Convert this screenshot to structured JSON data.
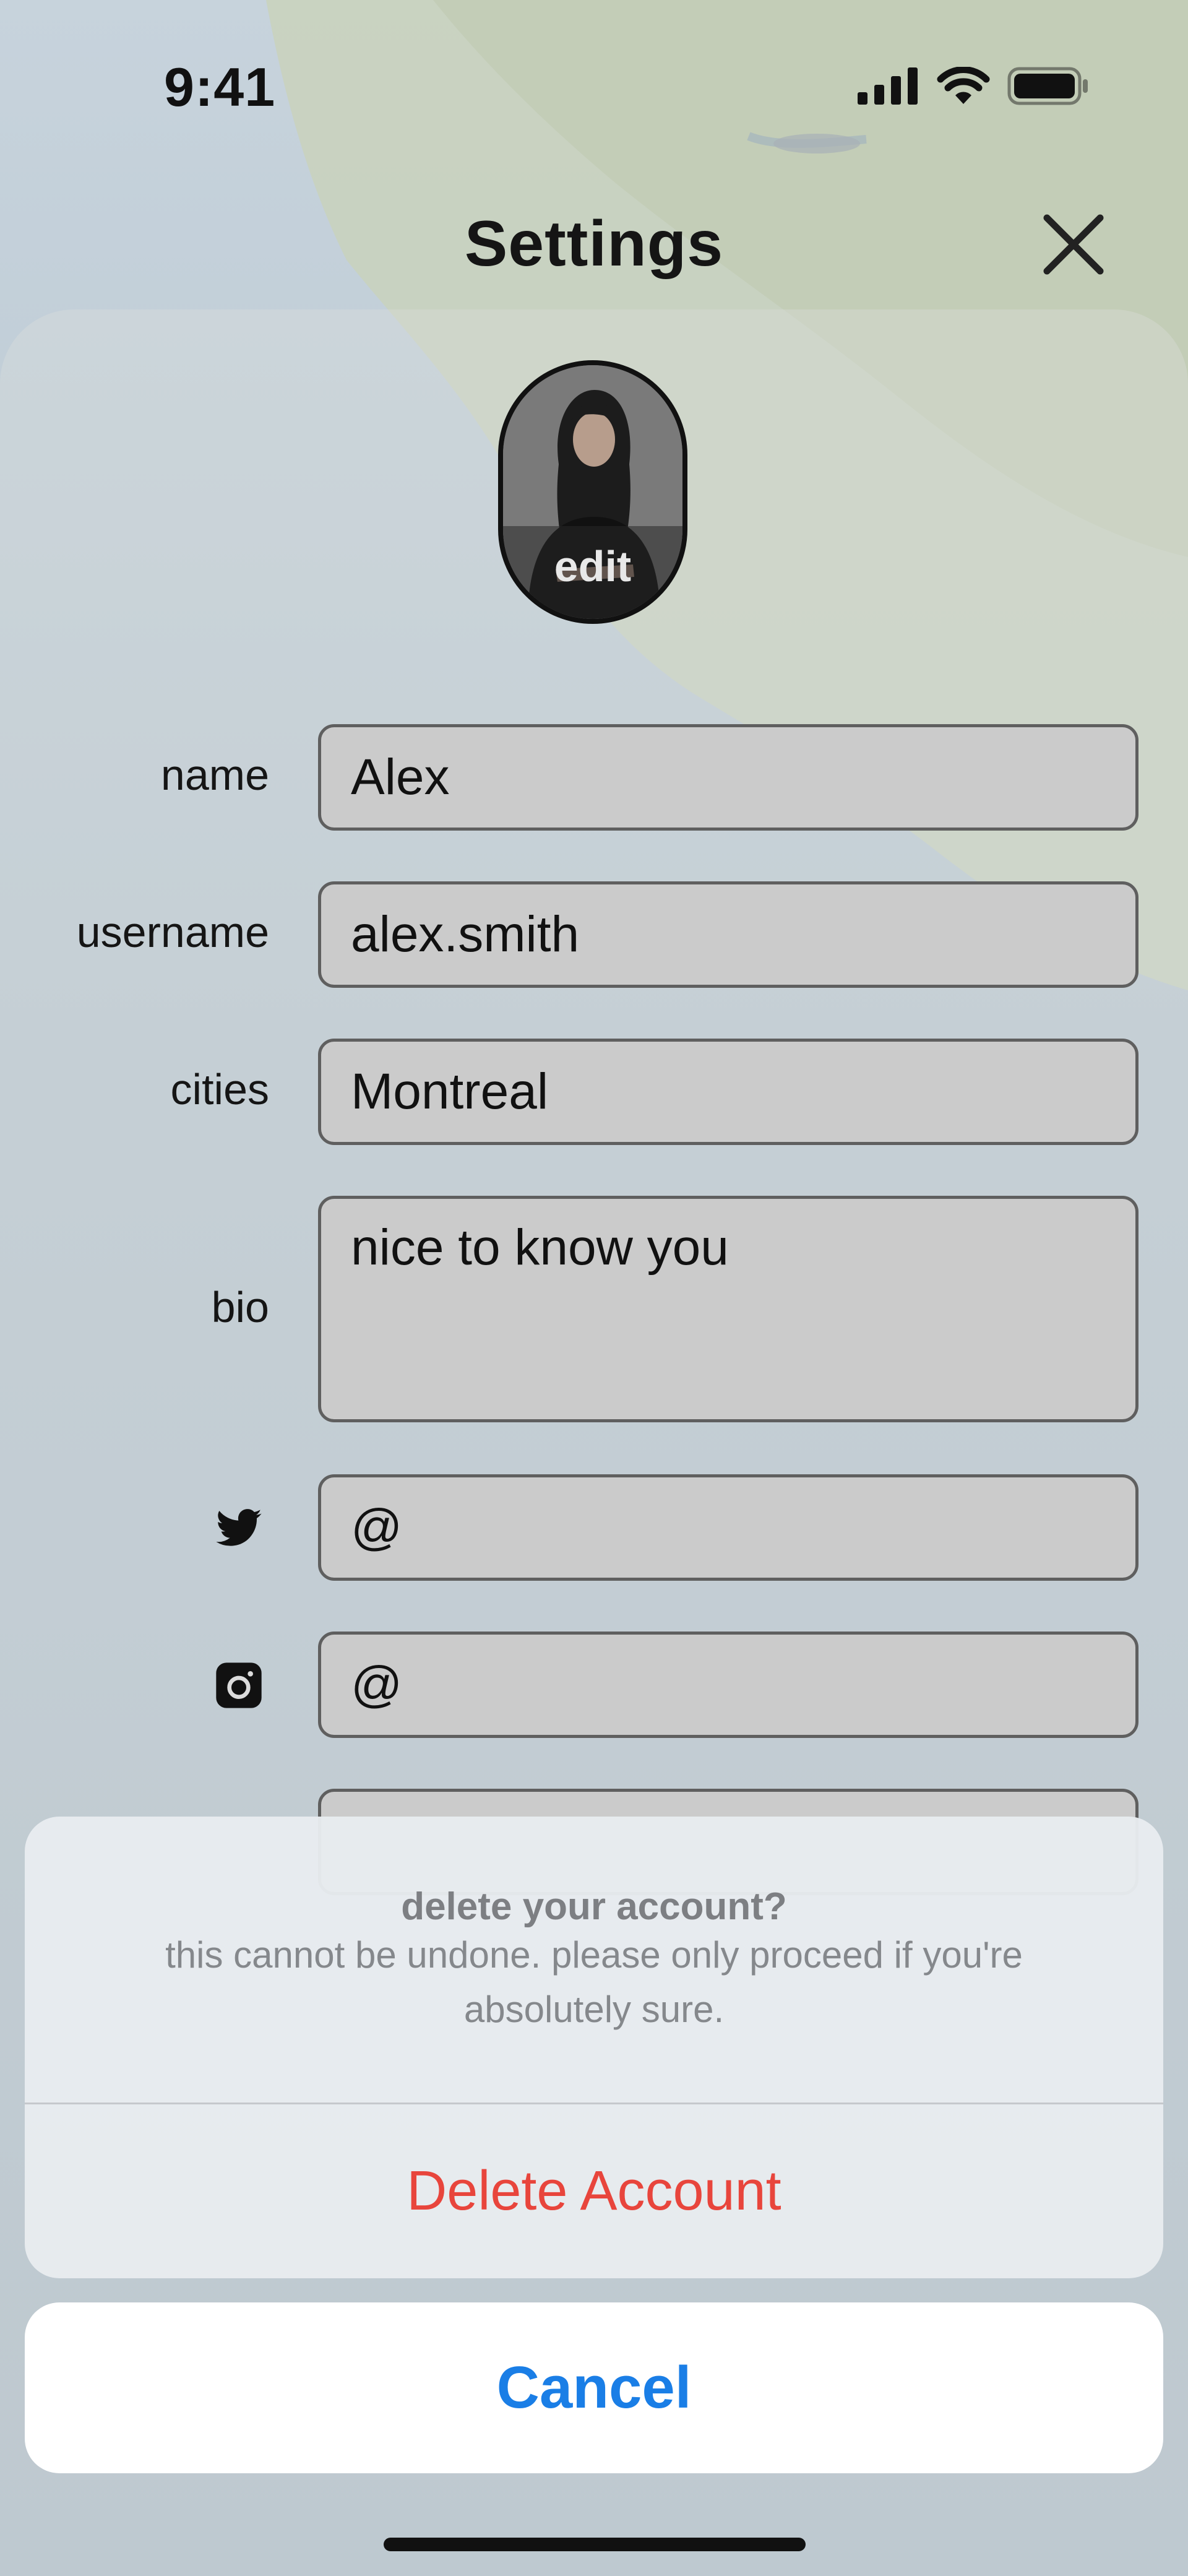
{
  "status_bar": {
    "time": "9:41",
    "icons": [
      "cellular-signal-icon",
      "wifi-icon",
      "battery-icon"
    ]
  },
  "header": {
    "title": "Settings",
    "close_icon": "close-icon"
  },
  "profile": {
    "avatar_edit_label": "edit"
  },
  "form": {
    "name_label": "name",
    "name_value": "Alex",
    "username_label": "username",
    "username_value": "alex.smith",
    "cities_label": "cities",
    "cities_value": "Montreal",
    "bio_label": "bio",
    "bio_value": "nice to know you",
    "twitter_icon": "twitter-icon",
    "twitter_value": "@",
    "instagram_icon": "instagram-icon",
    "instagram_value": "@"
  },
  "action_sheet": {
    "title": "delete your account?",
    "message": "this cannot be undone. please only proceed if you're absolutely sure.",
    "delete_label": "Delete Account",
    "cancel_label": "Cancel"
  },
  "colors": {
    "destructive": "#e8453c",
    "accent": "#1a7ee6",
    "field_background": "#cbcbcb"
  }
}
